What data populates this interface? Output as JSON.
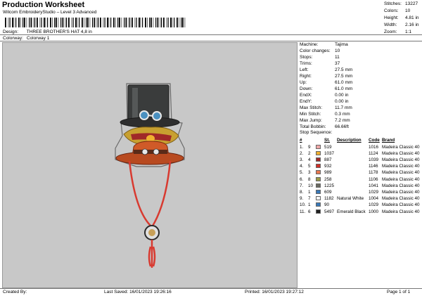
{
  "header": {
    "title": "Production Worksheet",
    "subtitle": "Wilcom EmbroideryStudio – Level 3 Advanced",
    "design_label": "Design:",
    "design_value": "THREE BROTHER'S HAT 4,8 in",
    "colorway_label": "Colorway:",
    "colorway_value": "Colorway 1"
  },
  "top_stats": [
    {
      "label": "Stitches:",
      "value": "13227"
    },
    {
      "label": "Colors:",
      "value": "10"
    },
    {
      "label": "Height:",
      "value": "4.81 in"
    },
    {
      "label": "Width:",
      "value": "2.16 in"
    },
    {
      "label": "Zoom:",
      "value": "1:1"
    }
  ],
  "specs": [
    {
      "label": "Machine:",
      "value": "Tajima"
    },
    {
      "label": "Color changes:",
      "value": "10"
    },
    {
      "label": "Stops:",
      "value": "11"
    },
    {
      "label": "Trims:",
      "value": "37"
    },
    {
      "label": "Left:",
      "value": "27.5 mm"
    },
    {
      "label": "Right:",
      "value": "27.5 mm"
    },
    {
      "label": "Up:",
      "value": "61.0 mm"
    },
    {
      "label": "Down:",
      "value": "61.0 mm"
    },
    {
      "label": "EndX:",
      "value": "0.00 in"
    },
    {
      "label": "EndY:",
      "value": "0.00 in"
    },
    {
      "label": "Max Stitch:",
      "value": "11.7 mm"
    },
    {
      "label": "Min Stitch:",
      "value": "0.3 mm"
    },
    {
      "label": "Max Jump:",
      "value": "7.2 mm"
    },
    {
      "label": "Total Bobbin:",
      "value": "66.66ft"
    }
  ],
  "stop_sequence_label": "Stop Sequence:",
  "stops_header": {
    "hash": "#",
    "st": "St.",
    "description": "Description",
    "code": "Code",
    "brand": "Brand"
  },
  "stops": [
    {
      "idx": "1.",
      "num": "9",
      "color": "#f0a8a8",
      "st": "519",
      "desc": "",
      "code": "1016",
      "brand": "Madeira Classic 40"
    },
    {
      "idx": "2.",
      "num": "2",
      "color": "#f0b030",
      "st": "1037",
      "desc": "",
      "code": "1124",
      "brand": "Madeira Classic 40"
    },
    {
      "idx": "3.",
      "num": "4",
      "color": "#a02828",
      "st": "887",
      "desc": "",
      "code": "1039",
      "brand": "Madeira Classic 40"
    },
    {
      "idx": "4.",
      "num": "5",
      "color": "#d03028",
      "st": "932",
      "desc": "",
      "code": "1146",
      "brand": "Madeira Classic 40"
    },
    {
      "idx": "5.",
      "num": "3",
      "color": "#e87850",
      "st": "989",
      "desc": "",
      "code": "1178",
      "brand": "Madeira Classic 40"
    },
    {
      "idx": "6.",
      "num": "8",
      "color": "#9a9a48",
      "st": "258",
      "desc": "",
      "code": "1106",
      "brand": "Madeira Classic 40"
    },
    {
      "idx": "7.",
      "num": "10",
      "color": "#6a6a60",
      "st": "1225",
      "desc": "",
      "code": "1041",
      "brand": "Madeira Classic 40"
    },
    {
      "idx": "8.",
      "num": "1",
      "color": "#3878b8",
      "st": "609",
      "desc": "",
      "code": "1029",
      "brand": "Madeira Classic 40"
    },
    {
      "idx": "9.",
      "num": "7",
      "color": "#f4f4f4",
      "st": "1182",
      "desc": "Natural White",
      "code": "1004",
      "brand": "Madeira Classic 40"
    },
    {
      "idx": "10.",
      "num": "1",
      "color": "#3878b8",
      "st": "90",
      "desc": "",
      "code": "1029",
      "brand": "Madeira Classic 40"
    },
    {
      "idx": "11.",
      "num": "6",
      "color": "#202020",
      "st": "5497",
      "desc": "Emerald Black",
      "code": "1000",
      "brand": "Madeira Classic 40"
    }
  ],
  "footer": {
    "created_by": "Created By:",
    "last_saved": "Last Saved: 16/01/2023 19:26:16",
    "printed": "Printed: 16/01/2023 19:27:12",
    "page": "Page 1 of 1"
  },
  "colors": {
    "preview_bg": "#c8c8c8",
    "hat_dark": "#3a3c3c",
    "hat_band": "#2e2e2e",
    "hat_orange": "#d05a28",
    "cord_red": "#d83a30",
    "goggle_blue": "#4a90c0"
  }
}
